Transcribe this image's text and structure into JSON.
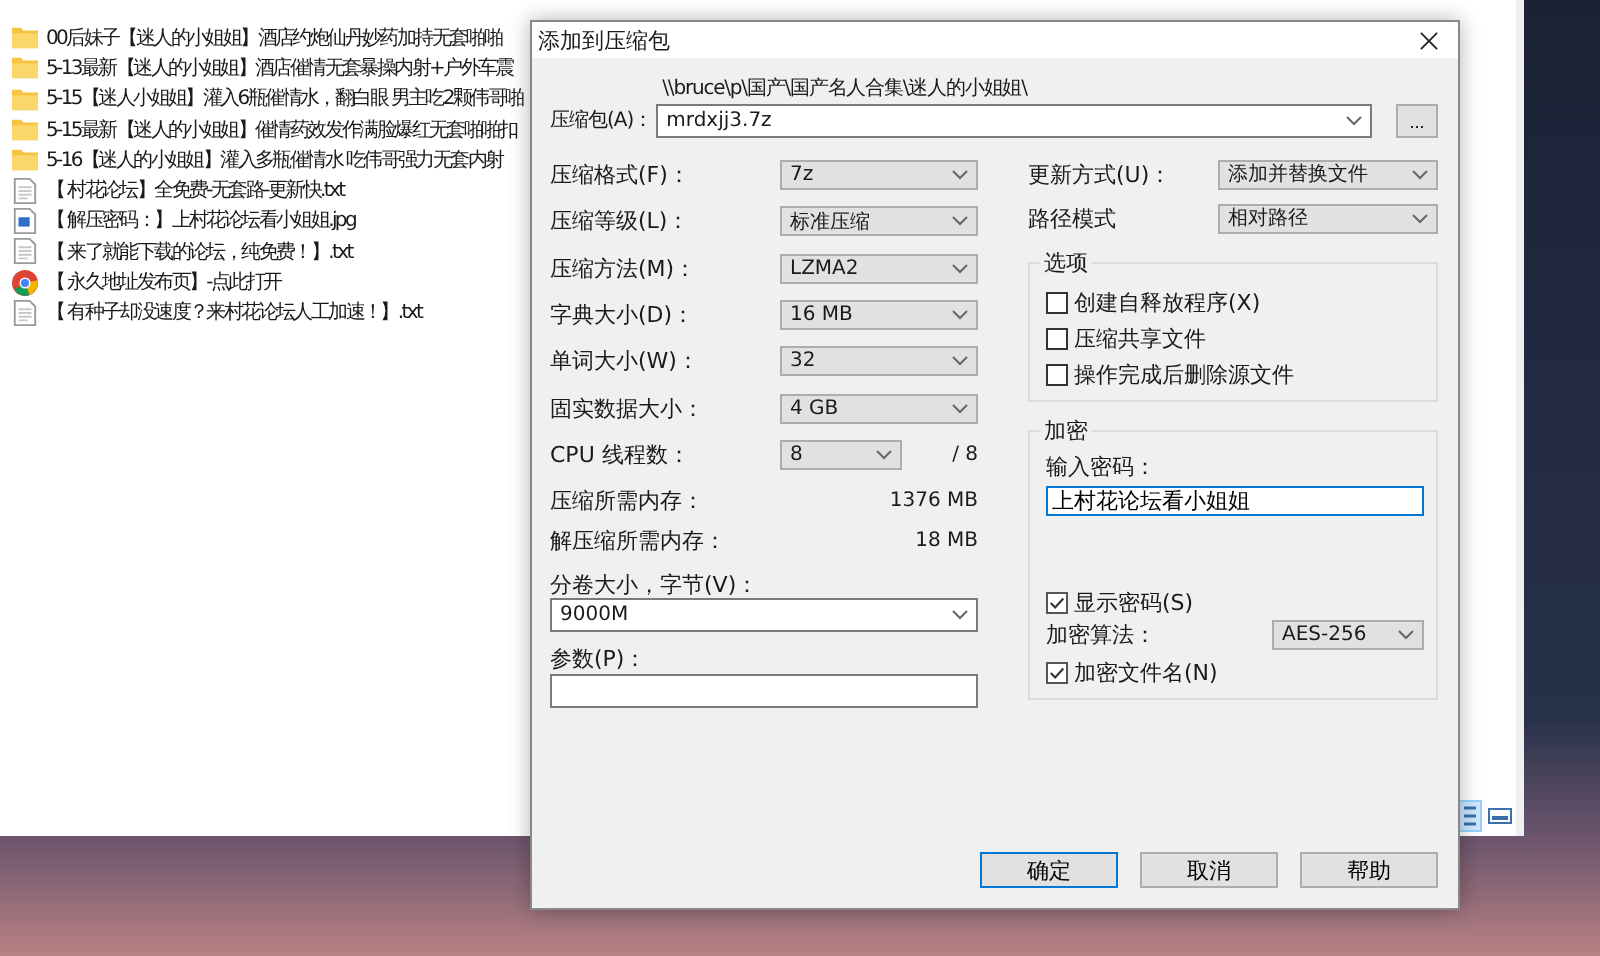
{
  "file_list": [
    {
      "kind": "folder",
      "name": "00后妹子【迷人的小姐姐】酒店约炮仙丹妙药加持无套啪啪"
    },
    {
      "kind": "folder",
      "name": "5-13最新【迷人的小姐姐】酒店催情无套暴操内射+户外车震"
    },
    {
      "kind": "folder",
      "name": "5-15【迷人小姐姐】灌入6瓶催情水，翻白眼 男主吃2颗伟哥啪"
    },
    {
      "kind": "folder",
      "name": "5-15最新【迷人的小姐姐】催情药效发作满脸爆红无套啪啪扣"
    },
    {
      "kind": "folder",
      "name": "5-16【迷人的小姐姐】灌入多瓶催情水 吃伟哥强力无套内射"
    },
    {
      "kind": "text",
      "name": "【 村花论坛】全免费-无套路-更新快.txt"
    },
    {
      "kind": "image",
      "name": "【 解压密码：】上村花论坛看小姐姐.jpg"
    },
    {
      "kind": "text",
      "name": "【 来了就能下载的论坛，纯免费！】.txt"
    },
    {
      "kind": "web",
      "name": "【 永久地址发布页】-点此打开"
    },
    {
      "kind": "text",
      "name": "【 有种子却没速度？来村花论坛人工加速！】.txt"
    }
  ],
  "view_buttons": [
    {
      "kind": "details",
      "selected": true
    },
    {
      "kind": "preview",
      "selected": false
    }
  ],
  "dialog": {
    "title": "添加到压缩包",
    "archive": {
      "label": "压缩包(A)：",
      "path": "\\\\bruce\\p\\国产\\国产名人合集\\迷人的小姐姐\\",
      "value": "mrdxjj3.7z",
      "browse": "..."
    },
    "settings": [
      {
        "kind": "dropdown",
        "label": "压缩格式(F)：",
        "value": "7z"
      },
      {
        "kind": "dropdown",
        "label": "压缩等级(L)：",
        "value": "标准压缩"
      },
      {
        "kind": "dropdown",
        "label": "压缩方法(M)：",
        "value": "LZMA2"
      },
      {
        "kind": "dropdown",
        "label": "字典大小(D)：",
        "value": "16 MB"
      },
      {
        "kind": "dropdown",
        "label": "单词大小(W)：",
        "value": "32"
      },
      {
        "kind": "dropdown",
        "label": "固实数据大小：",
        "value": "4 GB"
      },
      {
        "kind": "cpu",
        "label": "CPU 线程数：",
        "value": "8",
        "suffix": "/ 8"
      },
      {
        "kind": "info",
        "label": "压缩所需内存：",
        "value": "1376 MB"
      },
      {
        "kind": "info",
        "label": "解压缩所需内存：",
        "value": "18 MB"
      }
    ],
    "volume": {
      "label": "分卷大小，字节(V)：",
      "value": "9000M"
    },
    "parameters": {
      "label": "参数(P)："
    },
    "update_mode": {
      "label": "更新方式(U)：",
      "value": "添加并替换文件"
    },
    "path_mode": {
      "label": "路径模式",
      "value": "相对路径"
    },
    "options": {
      "title": "选项",
      "items": [
        {
          "label": "创建自释放程序(X)",
          "checked": false
        },
        {
          "label": "压缩共享文件",
          "checked": false
        },
        {
          "label": "操作完成后删除源文件",
          "checked": false
        }
      ]
    },
    "encryption": {
      "title": "加密",
      "password_label": "输入密码：",
      "password": "上村花论坛看小姐姐",
      "show_password": {
        "label": "显示密码(S)",
        "checked": true
      },
      "algorithm": {
        "label": "加密算法：",
        "value": "AES-256"
      },
      "encrypt_names": {
        "label": "加密文件名(N)",
        "checked": true
      }
    },
    "buttons": [
      {
        "label": "确定",
        "default": true
      },
      {
        "label": "取消",
        "default": false
      },
      {
        "label": "帮助",
        "default": false
      }
    ]
  }
}
